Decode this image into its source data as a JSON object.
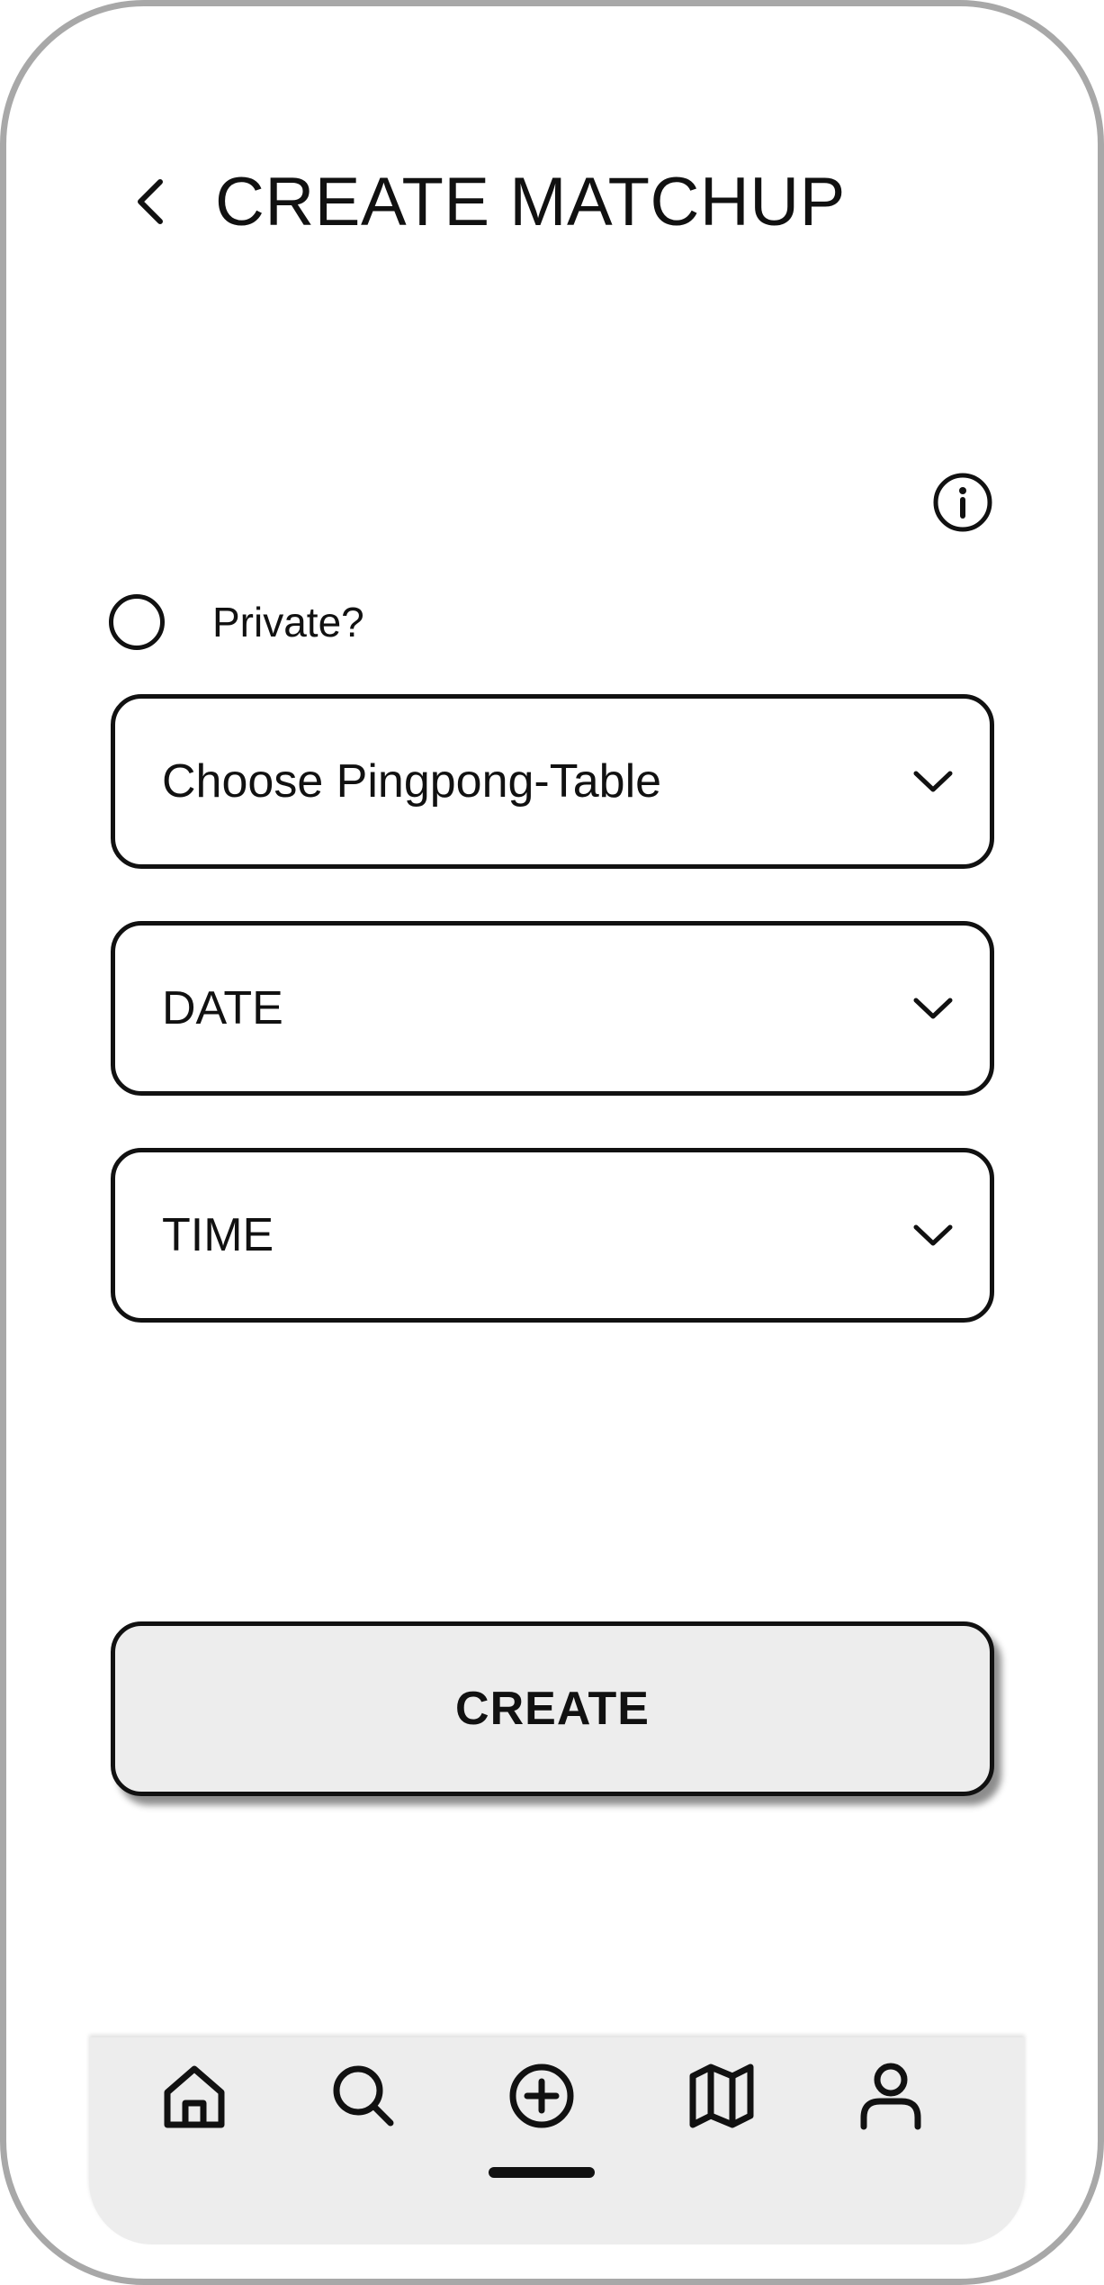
{
  "header": {
    "title": "CREATE MATCHUP",
    "back_icon": "chevron-left-icon"
  },
  "info": {
    "icon": "info-icon"
  },
  "private_option": {
    "label": "Private?",
    "checked": false
  },
  "form": {
    "table_select": {
      "value": "Choose Pingpong-Table",
      "icon": "chevron-down-icon"
    },
    "date_select": {
      "value": "DATE",
      "icon": "chevron-down-icon"
    },
    "time_select": {
      "value": "TIME",
      "icon": "chevron-down-icon"
    },
    "create_label": "CREATE"
  },
  "bottom_nav": {
    "items": [
      {
        "icon": "home-icon",
        "active": false
      },
      {
        "icon": "search-icon",
        "active": false
      },
      {
        "icon": "add-circle-icon",
        "active": true
      },
      {
        "icon": "map-icon",
        "active": false
      },
      {
        "icon": "user-icon",
        "active": false
      }
    ]
  },
  "colors": {
    "stroke": "#111111",
    "frame": "#a8a8a8",
    "button_bg": "#ededed",
    "nav_bg": "#ededed"
  }
}
